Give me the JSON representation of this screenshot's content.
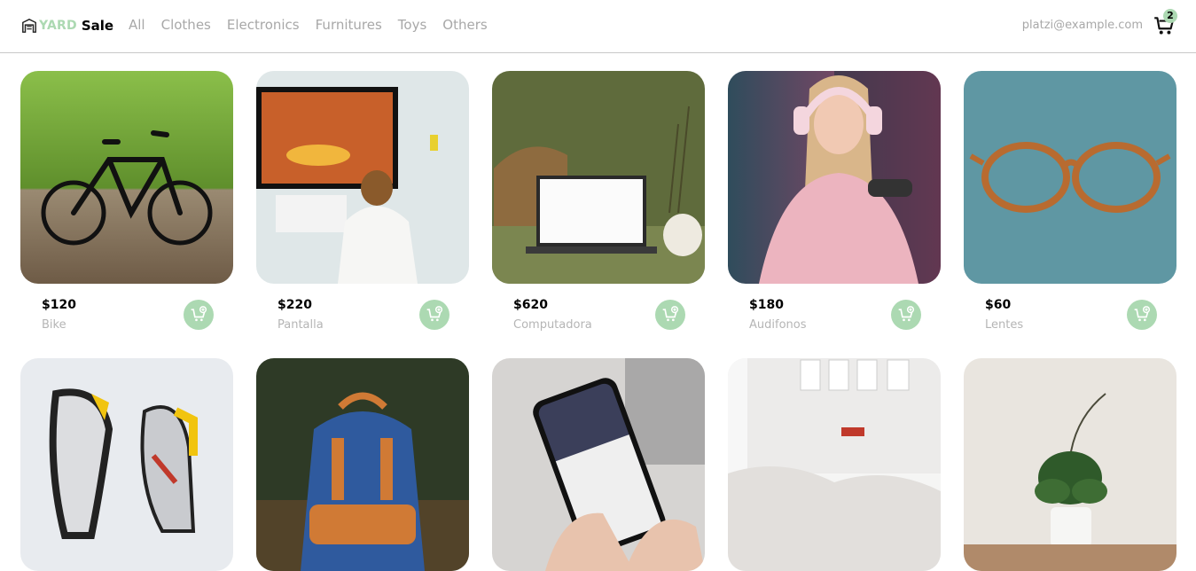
{
  "brand": {
    "yard": "YARD",
    "sale": "Sale"
  },
  "nav": {
    "links": [
      "All",
      "Clothes",
      "Electronics",
      "Furnitures",
      "Toys",
      "Others"
    ],
    "email": "platzi@example.com",
    "cart_count": "2"
  },
  "products": [
    {
      "price": "$120",
      "name": "Bike"
    },
    {
      "price": "$220",
      "name": "Pantalla"
    },
    {
      "price": "$620",
      "name": "Computadora"
    },
    {
      "price": "$180",
      "name": "Audifonos"
    },
    {
      "price": "$60",
      "name": "Lentes"
    },
    {
      "price": "",
      "name": ""
    },
    {
      "price": "",
      "name": ""
    },
    {
      "price": "",
      "name": ""
    },
    {
      "price": "",
      "name": ""
    },
    {
      "price": "",
      "name": ""
    }
  ],
  "colors": {
    "accent": "#acd9b2",
    "muted": "#a8a8a8"
  },
  "icons": {
    "logo": "store-icon",
    "cart": "cart-icon",
    "add": "add-to-cart-icon"
  }
}
